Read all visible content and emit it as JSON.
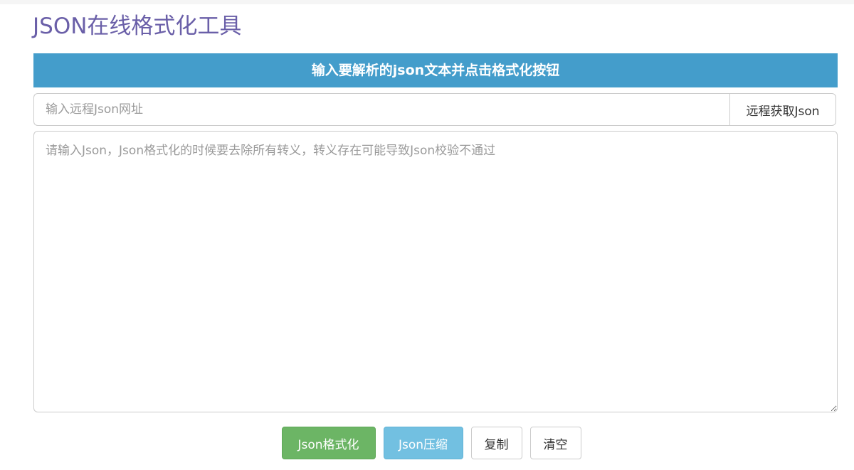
{
  "page": {
    "title": "JSON在线格式化工具"
  },
  "banner": {
    "text": "输入要解析的json文本并点击格式化按钮"
  },
  "remote": {
    "url_placeholder": "输入远程Json网址",
    "url_value": "",
    "fetch_label": "远程获取Json"
  },
  "editor": {
    "placeholder": "请输入Json，Json格式化的时候要去除所有转义，转义存在可能导致Json校验不通过",
    "value": ""
  },
  "actions": {
    "format_label": "Json格式化",
    "compress_label": "Json压缩",
    "copy_label": "复制",
    "clear_label": "清空"
  },
  "colors": {
    "title": "#6a5fa8",
    "banner": "#449dcb",
    "format_button": "#6cb565",
    "compress_button": "#72c0e1"
  }
}
